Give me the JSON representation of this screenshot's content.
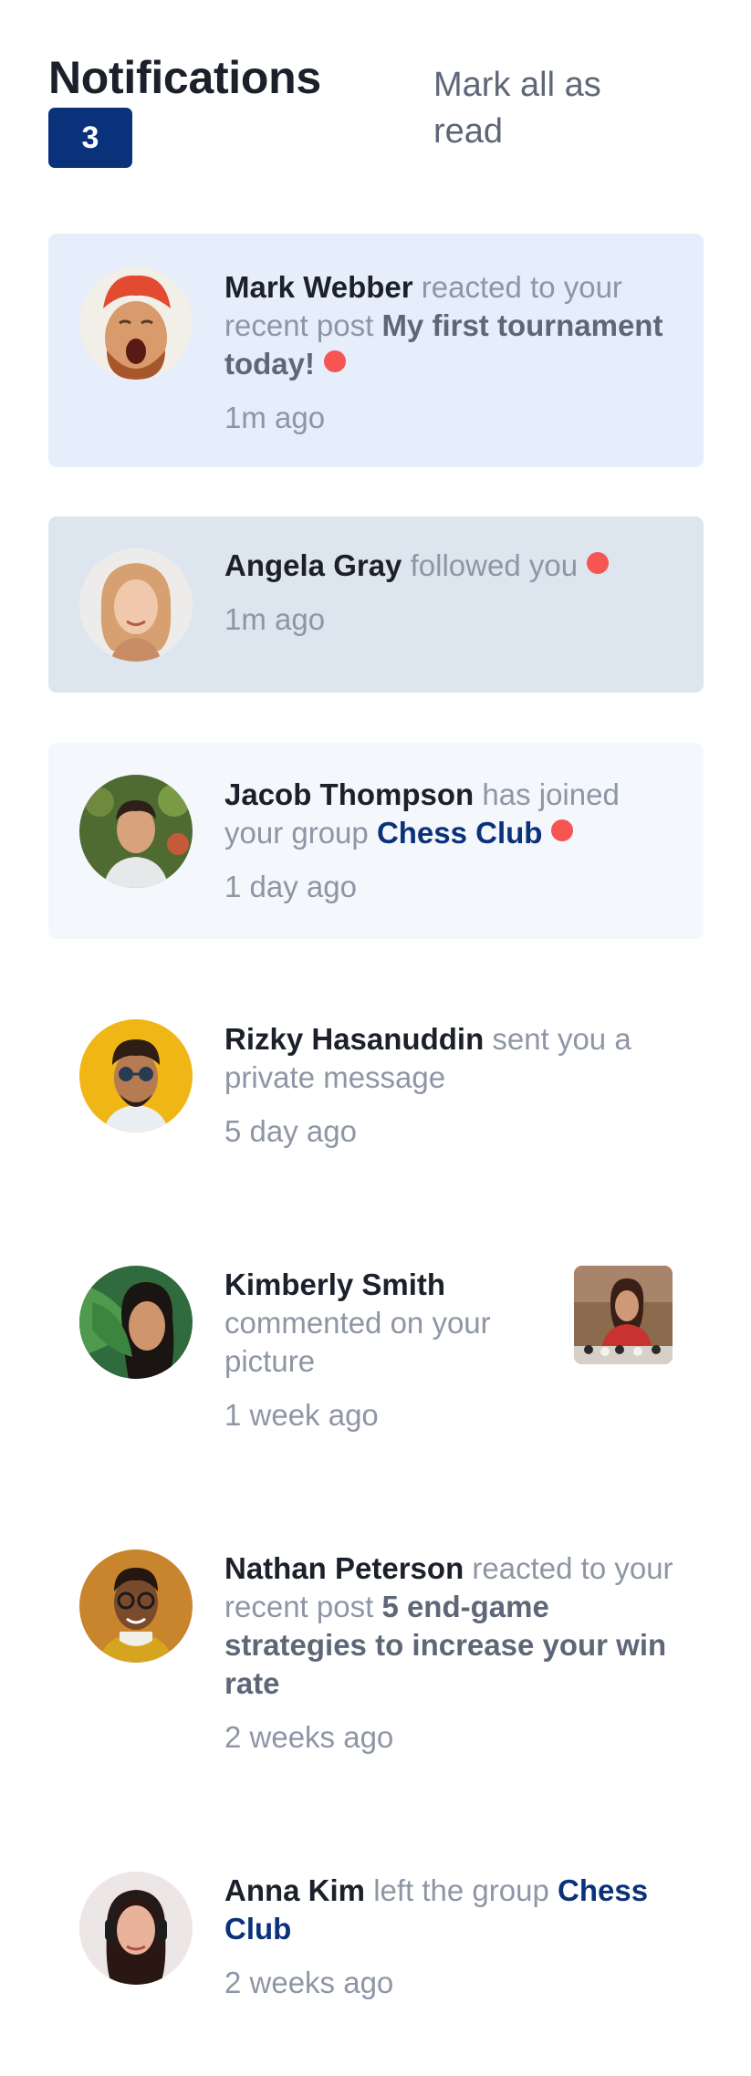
{
  "header": {
    "title": "Notifications",
    "count": "3",
    "mark_all": "Mark all as read"
  },
  "notifications": [
    {
      "name": "Mark Webber",
      "action": "reacted to your recent post",
      "target": "My first tournament today!",
      "time": "1m ago",
      "unread": true
    },
    {
      "name": "Angela Gray",
      "action": "followed you",
      "time": "1m ago",
      "unread": true
    },
    {
      "name": "Jacob Thompson",
      "action": "has joined your group",
      "target": "Chess Club",
      "time": "1 day ago",
      "unread": true
    },
    {
      "name": "Rizky Hasanuddin",
      "action": "sent you a private message",
      "time": "5 day ago",
      "unread": false
    },
    {
      "name": "Kimberly Smith",
      "action": "commented on your picture",
      "time": "1 week ago",
      "unread": false
    },
    {
      "name": "Nathan Peterson",
      "action": "reacted to your recent post",
      "target": "5 end-game strategies to increase your win rate",
      "time": "2 weeks ago",
      "unread": false
    },
    {
      "name": "Anna Kim",
      "action": "left the group",
      "target": "Chess Club",
      "time": "2 weeks ago",
      "unread": false
    }
  ],
  "colors": {
    "unread_background": "#e5eefa",
    "dot": "#f65552",
    "badge": "#0a327b",
    "group_link": "#0a327b"
  }
}
